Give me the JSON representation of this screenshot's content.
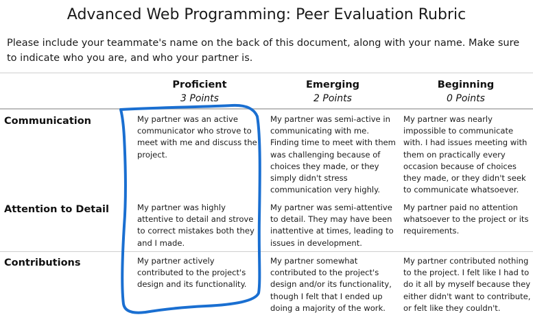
{
  "document": {
    "title": "Advanced Web Programming: Peer Evaluation Rubric",
    "instructions": "Please include your teammate's name on the back of this document, along with your name. Make sure to indicate who you are, and who your partner is."
  },
  "rubric": {
    "columns": [
      {
        "name": "Proficient",
        "points": "3 Points"
      },
      {
        "name": "Emerging",
        "points": "2 Points"
      },
      {
        "name": "Beginning",
        "points": "0 Points"
      }
    ],
    "rows": [
      {
        "label": "Communication",
        "cells": [
          "My partner was an active communicator who strove to meet with me and discuss the project.",
          "My partner was semi-active in communicating with me. Finding time to meet with them was challenging because of choices they made, or they simply didn't stress communication very highly.",
          "My partner was nearly impossible to communicate with. I had issues meeting with them on practically every occasion because of choices they made, or they didn't seek to communicate whatsoever."
        ]
      },
      {
        "label": "Attention to Detail",
        "cells": [
          "My partner was highly attentive to detail and strove to correct mistakes both they and I made.",
          "My partner was semi-attentive to detail. They may have been inattentive at times, leading to issues in development.",
          "My partner paid no attention whatsoever to the project or its requirements."
        ]
      },
      {
        "label": "Contributions",
        "cells": [
          "My partner actively contributed to the project's design and its functionality.",
          "My partner somewhat contributed to the project's design and/or its functionality, though I felt that I ended up doing a majority of the work.",
          "My partner contributed nothing to the project. I felt like I had to do it all by myself because they either didn't want to contribute, or felt like they couldn't."
        ]
      }
    ]
  },
  "annotation": {
    "color": "#1a6fd1",
    "shape": "hand-drawn-outline"
  }
}
